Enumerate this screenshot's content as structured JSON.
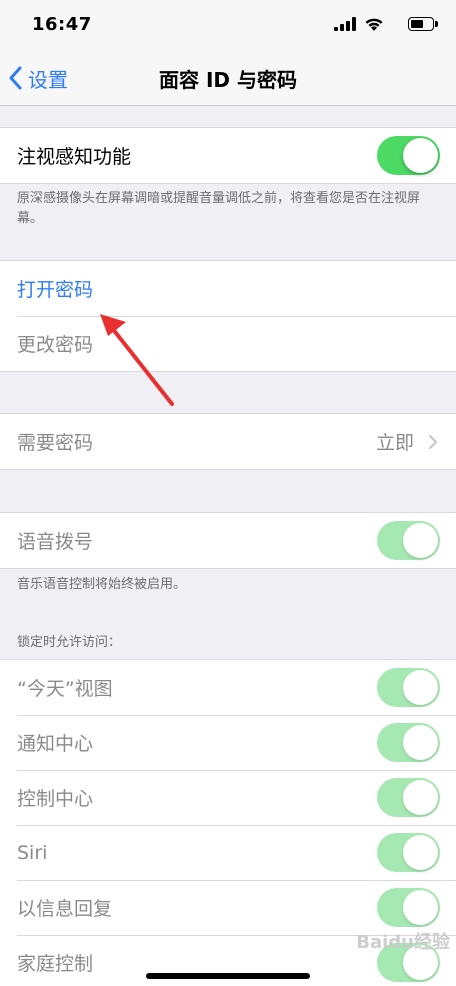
{
  "status_bar": {
    "time": "16:47",
    "icons": [
      "signal-icon",
      "wifi-icon",
      "battery-icon"
    ]
  },
  "nav": {
    "back_label": "设置",
    "title": "面容 ID 与密码"
  },
  "attention": {
    "label": "注视感知功能",
    "toggle_on": true,
    "footnote": "原深感摄像头在屏幕调暗或提醒音量调低之前，将查看您是否在注视屏幕。"
  },
  "passcode": {
    "turn_on_label": "打开密码",
    "change_label": "更改密码"
  },
  "require": {
    "label": "需要密码",
    "value": "立即"
  },
  "voice_dial": {
    "label": "语音拨号",
    "toggle_on": true,
    "footnote": "音乐语音控制将始终被启用。"
  },
  "lock_access": {
    "header": "锁定时允许访问：",
    "items": [
      {
        "label": "“今天”视图",
        "toggle_on": true
      },
      {
        "label": "通知中心",
        "toggle_on": true
      },
      {
        "label": "控制中心",
        "toggle_on": true
      },
      {
        "label": "Siri",
        "toggle_on": true
      },
      {
        "label": "以信息回复",
        "toggle_on": true
      },
      {
        "label": "家庭控制",
        "toggle_on": true
      }
    ]
  },
  "watermark": "Baidu经验",
  "colors": {
    "accent": "#2f7cf6",
    "toggle_green": "#4cd964",
    "toggle_disabled": "#a6e8b1",
    "annotation_arrow": "#e8312f"
  }
}
